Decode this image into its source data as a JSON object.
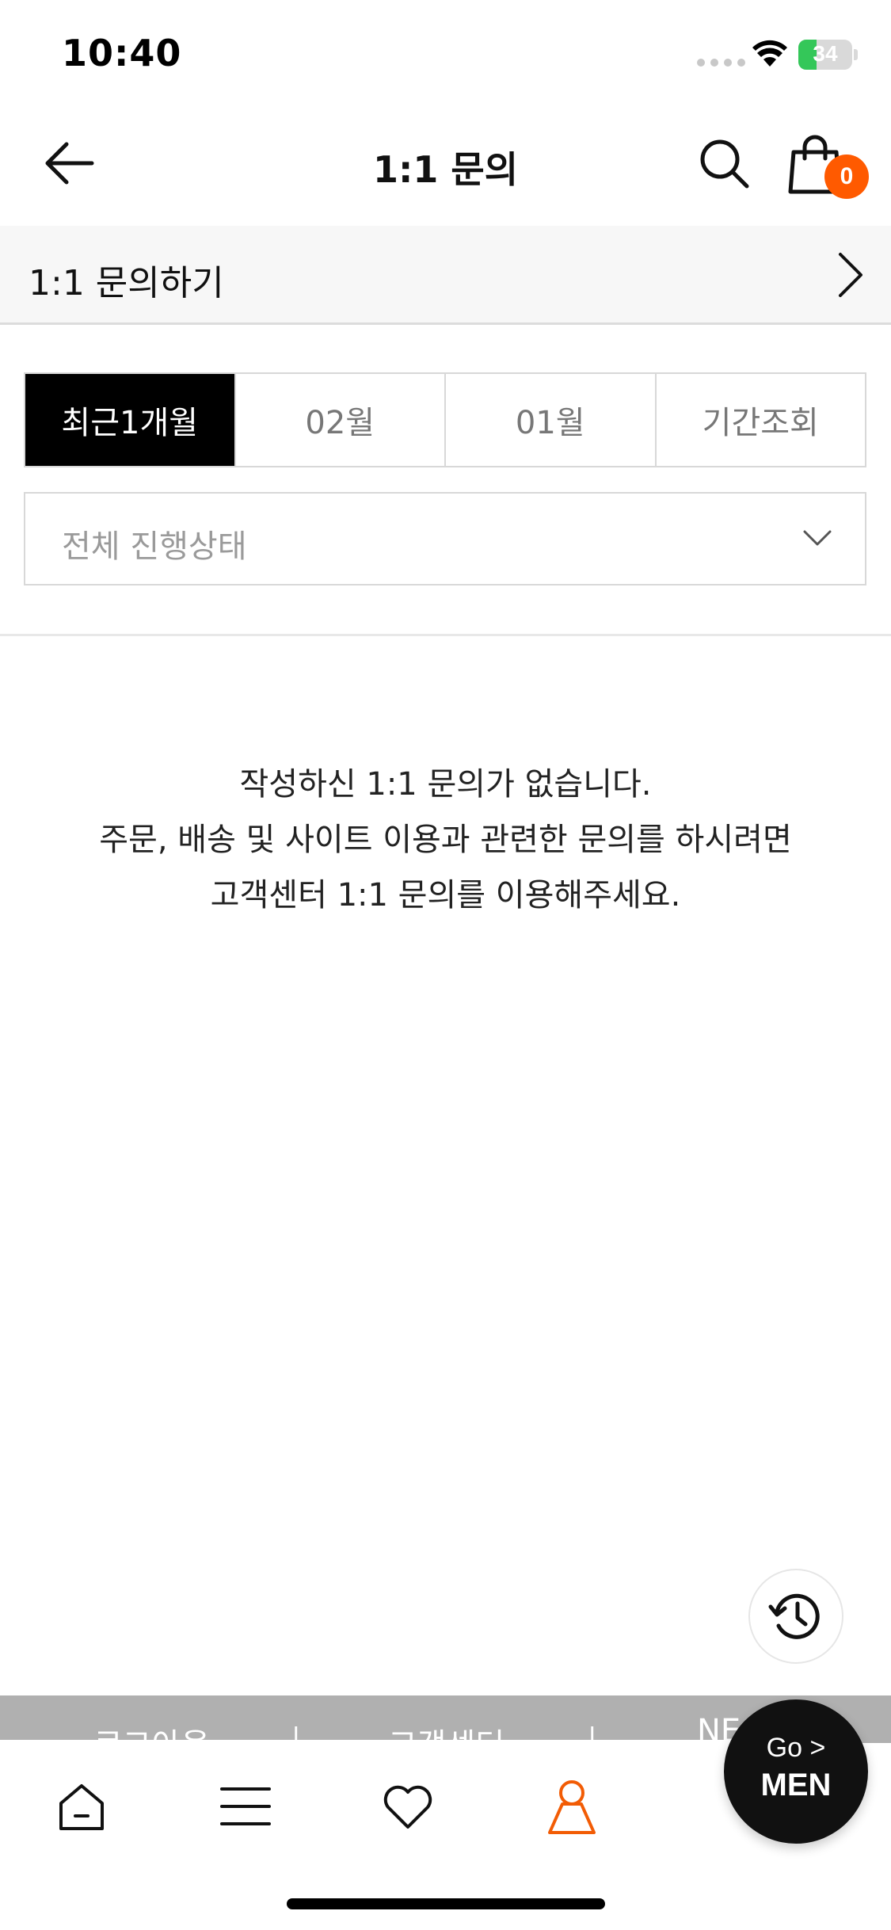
{
  "status_bar": {
    "time": "10:40",
    "battery": "34",
    "battery_level": 0.34
  },
  "header": {
    "title": "1:1 문의",
    "cart_count": "0"
  },
  "inquiry_link": {
    "label": "1:1 문의하기"
  },
  "period_tabs": [
    {
      "label": "최근1개월",
      "active": true
    },
    {
      "label": "02월",
      "active": false
    },
    {
      "label": "01월",
      "active": false
    },
    {
      "label": "기간조회",
      "active": false
    }
  ],
  "status_filter": {
    "selected": "전체 진행상태"
  },
  "empty": {
    "line1": "작성하신 1:1 문의가 없습니다.",
    "line2": "주문, 배송 및 사이트 이용과 관련한 문의를 하시려면",
    "line3": "고객센터 1:1 문의를 이용해주세요."
  },
  "footer": {
    "logout": "로그아웃",
    "separator": "|",
    "customer_center": "고객센터",
    "notice": "NE"
  },
  "go_men": {
    "top": "Go >",
    "main": "MEN"
  },
  "tab_bar": {
    "items": [
      {
        "name": "home-icon"
      },
      {
        "name": "menu-icon"
      },
      {
        "name": "heart-icon"
      },
      {
        "name": "user-icon",
        "active": true
      }
    ],
    "active_color": "#f25c05"
  },
  "colors": {
    "accent": "#ff5a00",
    "active_tab_bg": "#000000"
  }
}
